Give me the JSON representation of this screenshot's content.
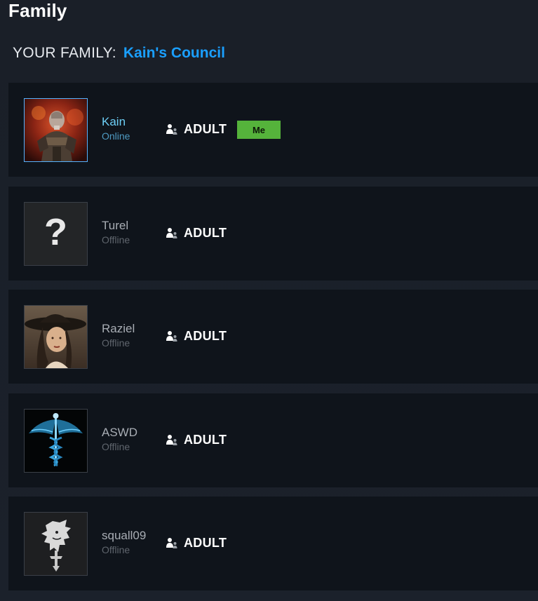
{
  "page": {
    "title": "Family"
  },
  "family": {
    "label": "YOUR FAMILY:",
    "name": "Kain's Council"
  },
  "members": [
    {
      "name": "Kain",
      "status": "Online",
      "role": "ADULT",
      "badge": "Me",
      "avatar_icon": "warrior-avatar-icon"
    },
    {
      "name": "Turel",
      "status": "Offline",
      "role": "ADULT",
      "avatar_icon": "question-mark-avatar-icon"
    },
    {
      "name": "Raziel",
      "status": "Offline",
      "role": "ADULT",
      "avatar_icon": "lady-in-hat-avatar-icon"
    },
    {
      "name": "ASWD",
      "status": "Offline",
      "role": "ADULT",
      "avatar_icon": "caduceus-avatar-icon"
    },
    {
      "name": "squall09",
      "status": "Offline",
      "role": "ADULT",
      "avatar_icon": "griever-lion-avatar-icon"
    }
  ],
  "colors": {
    "accent": "#1a9fff",
    "online": "#6dcff6",
    "badge": "#55b33b",
    "row_bg": "#0f141b"
  }
}
